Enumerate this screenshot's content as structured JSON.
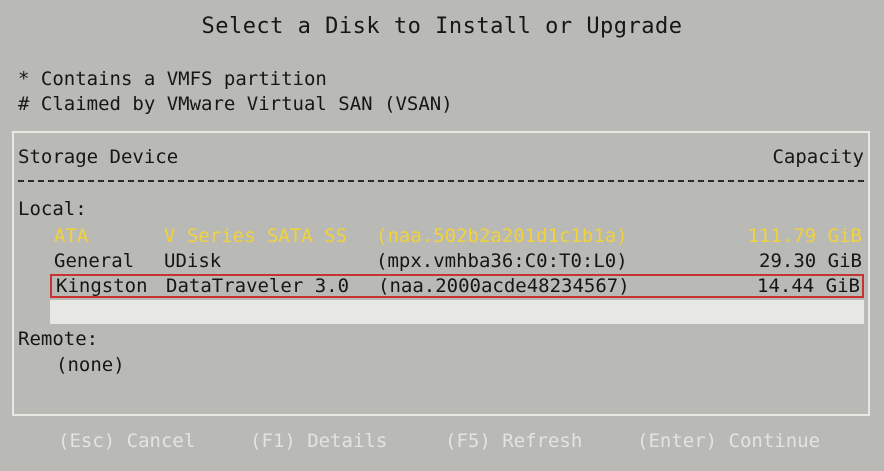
{
  "title": "Select a Disk to Install or Upgrade",
  "legend": [
    "* Contains a VMFS partition",
    "# Claimed by VMware Virtual SAN (VSAN)"
  ],
  "table": {
    "header_device": "Storage Device",
    "header_capacity": "Capacity",
    "local_label": "Local:",
    "rows": [
      {
        "vendor": "ATA",
        "model": "V Series SATA SS",
        "device_id": "(naa.502b2a201d1c1b1a)",
        "capacity": "111.79 GiB"
      },
      {
        "vendor": "General",
        "model": "UDisk",
        "device_id": "(mpx.vmhba36:C0:T0:L0)",
        "capacity": "29.30 GiB"
      },
      {
        "vendor": "Kingston",
        "model": "DataTraveler 3.0",
        "device_id": "(naa.2000acde48234567)",
        "capacity": "14.44 GiB"
      }
    ],
    "remote_label": "Remote:",
    "remote_none": "(none)"
  },
  "footer": {
    "cancel": "(Esc) Cancel",
    "details": "(F1) Details",
    "refresh": "(F5) Refresh",
    "continue": "(Enter) Continue"
  },
  "colors": {
    "background": "#b9b9b6",
    "highlight_text": "#f2d23a",
    "selection_border": "#c73333",
    "footer_text": "#e3e3df"
  }
}
